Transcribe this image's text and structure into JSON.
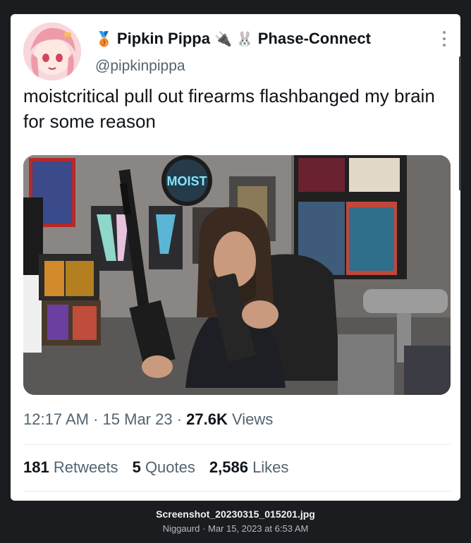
{
  "tweet": {
    "display_name": "Pipkin Pippa",
    "badge_emoji": "🥉",
    "plug_emoji": "🔌",
    "bunny_emoji": "🐰",
    "affiliation": "Phase-Connect",
    "handle": "@pipkinpippa",
    "text": "moistcritical pull out firearms flashbanged my brain for some reason",
    "media_alt": "Photo of streamer holding a rifle and magazine in a room with posters and a MOIST sign",
    "media_sign_text": "MOIST",
    "time": "12:17 AM",
    "date": "15 Mar 23",
    "views_count": "27.6K",
    "views_label": "Views",
    "retweets_count": "181",
    "retweets_label": "Retweets",
    "quotes_count": "5",
    "quotes_label": "Quotes",
    "likes_count": "2,586",
    "likes_label": "Likes"
  },
  "caption": {
    "filename": "Screenshot_20230315_015201.jpg",
    "uploader": "Niggaurd",
    "timestamp": "Mar 15, 2023 at 6:53 AM"
  },
  "colors": {
    "text_primary": "#0f1419",
    "text_secondary": "#536471",
    "viewer_bg": "#1b1c1f"
  }
}
